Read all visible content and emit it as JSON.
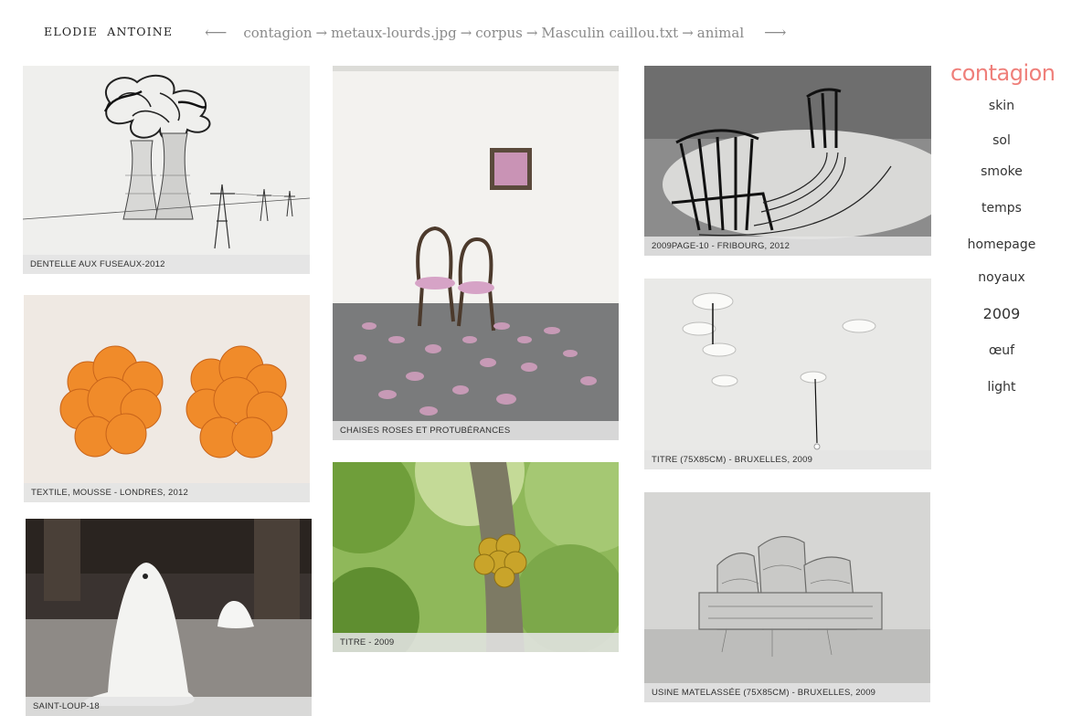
{
  "site": {
    "author": "ELODIE  ANTOINE"
  },
  "breadcrumb": {
    "prev_icon": "left-arrow",
    "next_icon": "right-arrow",
    "items": [
      "contagion",
      "metaux-lourds.jpg",
      "corpus",
      "Masculin caillou.txt",
      "animal"
    ],
    "separator": "→"
  },
  "sidebar": {
    "title": "contagion",
    "title_color": "#ef7f7a",
    "items": [
      "skin",
      "sol",
      "smoke",
      "temps",
      "homepage",
      "noyaux",
      "2009",
      "œuf",
      "light"
    ]
  },
  "gallery": {
    "tiles": [
      {
        "caption": "DENTELLE AUX FUSEAUX-2012",
        "subject": "lace-power-plant"
      },
      {
        "caption": "TEXTILE, MOUSSE - LONDRES, 2012",
        "subject": "orange-foam"
      },
      {
        "caption": "SAINT-LOUP-18",
        "subject": "ghost-sculptures"
      },
      {
        "caption": "CHAISES ROSES ET PROTUBÉRANCES",
        "subject": "pink-chairs"
      },
      {
        "caption": "TITRE - 2009",
        "subject": "tree-growth"
      },
      {
        "caption": "2009PAGE-10 - FRIBOURG, 2012",
        "subject": "rocking-chair"
      },
      {
        "caption": "TITRE (75X85CM) - BRUXELLES, 2009",
        "subject": "ceiling-roses"
      },
      {
        "caption": "USINE MATELASSÉE (75X85CM) - BRUXELLES, 2009",
        "subject": "quilted-factory"
      }
    ]
  }
}
